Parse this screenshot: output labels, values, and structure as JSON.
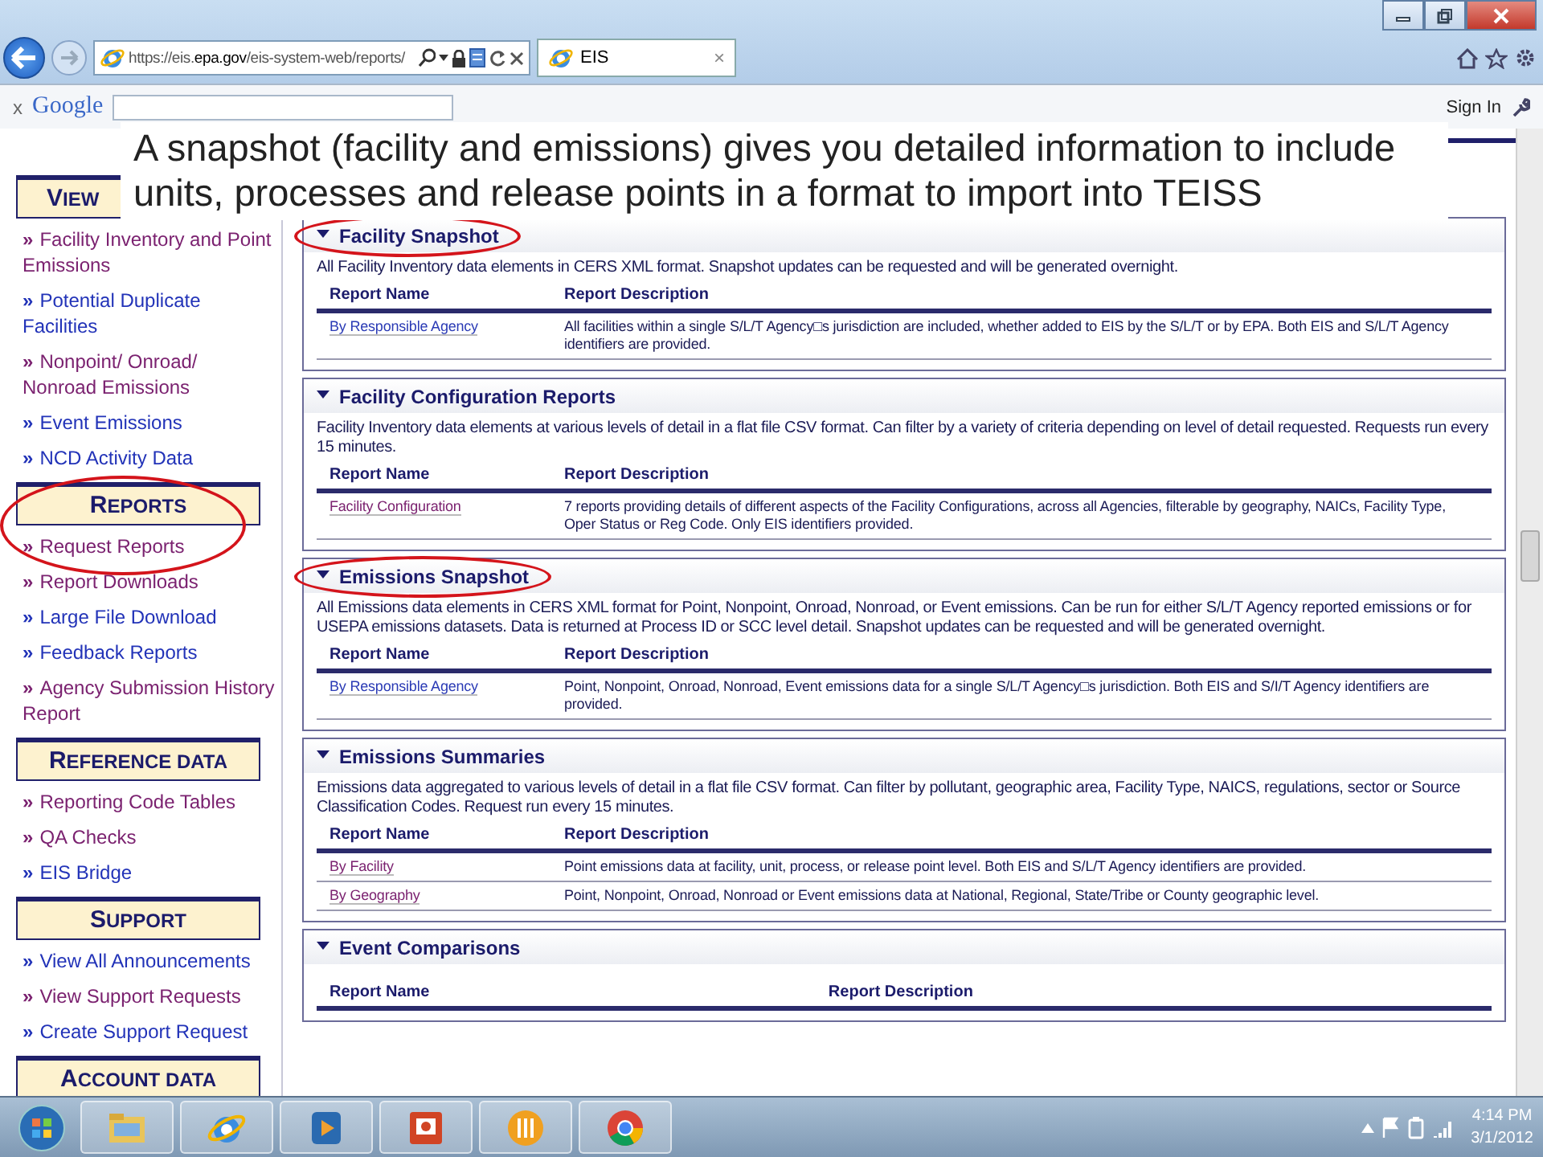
{
  "browser": {
    "address": "https://eis.**epa.gov**/eis-system-web/reports/",
    "tab": {
      "label": "EIS",
      "close": "×"
    }
  },
  "toolbar": {
    "close": "x",
    "brand": "Google",
    "sign_in": "Sign In"
  },
  "callout": {
    "text": "A snapshot (facility and emissions) gives you detailed information to include units, processes and release points in a format to import into TEISS"
  },
  "sidebar": {
    "sections": [
      {
        "heading": "VIEW",
        "circled": false,
        "items": [
          {
            "marker": "»",
            "label": "Facility Inventory and Point Emissions",
            "visited": true
          },
          {
            "marker": "»",
            "label": "Potential Duplicate Facilities",
            "visited": false
          },
          {
            "marker": "»",
            "label": "Nonpoint/ Onroad/ Nonroad Emissions",
            "visited": true
          },
          {
            "marker": "»",
            "label": "Event Emissions",
            "visited": false
          },
          {
            "marker": "»",
            "label": "NCD Activity Data",
            "visited": false
          }
        ]
      },
      {
        "heading": "REPORTS",
        "circled": true,
        "items": [
          {
            "marker": "»",
            "label": "Request Reports",
            "visited": true
          },
          {
            "marker": "»",
            "label": "Report Downloads",
            "visited": true
          },
          {
            "marker": "»",
            "label": "Large File Download",
            "visited": false
          },
          {
            "marker": "»",
            "label": "Feedback Reports",
            "visited": false
          },
          {
            "marker": "»",
            "label": "Agency Submission History Report",
            "visited": true
          }
        ]
      },
      {
        "heading": "REFERENCE DATA",
        "circled": false,
        "items": [
          {
            "marker": "»",
            "label": "Reporting Code Tables",
            "visited": true
          },
          {
            "marker": "»",
            "label": "QA Checks",
            "visited": true
          },
          {
            "marker": "»",
            "label": "EIS Bridge",
            "visited": false
          }
        ]
      },
      {
        "heading": "SUPPORT",
        "circled": false,
        "items": [
          {
            "marker": "»",
            "label": "View All Announcements",
            "visited": false
          },
          {
            "marker": "»",
            "label": "View Support Requests",
            "visited": true
          },
          {
            "marker": "»",
            "label": "Create Support Request",
            "visited": false
          }
        ]
      },
      {
        "heading": "ACCOUNT DATA",
        "circled": false
      }
    ]
  },
  "sections": [
    {
      "title": "Facility Snapshot",
      "expanded": true,
      "circled": true,
      "description": "All Facility Inventory data elements in CERS XML format. Snapshot updates can be requested and will be generated overnight.",
      "columns": [
        "Report Name",
        "Report Description"
      ],
      "rows": [
        {
          "name": "By Responsible Agency",
          "visited": false,
          "description": "All facilities within a single S/L/T Agency□s jurisdiction are included, whether added to EIS by the S/L/T or by EPA. Both EIS and S/L/T Agency identifiers are provided."
        }
      ]
    },
    {
      "title": "Facility Configuration Reports",
      "expanded": true,
      "circled": false,
      "description": "Facility Inventory data elements at various levels of detail in a flat file CSV format. Can filter by a variety of criteria depending on level of detail requested. Requests run every 15 minutes.",
      "columns": [
        "Report Name",
        "Report Description"
      ],
      "rows": [
        {
          "name": "Facility Configuration",
          "visited": true,
          "description": "7 reports providing details of different aspects of the Facility Configurations, across all Agencies, filterable by geography, NAICs, Facility Type, Oper Status or Reg Code. Only EIS identifiers provided."
        }
      ]
    },
    {
      "title": "Emissions Snapshot",
      "expanded": true,
      "circled": true,
      "description": "All Emissions data elements in CERS XML format for Point, Nonpoint, Onroad, Nonroad, or Event emissions. Can be run for either S/L/T Agency reported emissions or for USEPA emissions datasets. Data is returned at Process ID or SCC level detail. Snapshot updates can be requested and will be generated overnight.",
      "columns": [
        "Report Name",
        "Report Description"
      ],
      "rows": [
        {
          "name": "By Responsible Agency",
          "visited": false,
          "description": "Point, Nonpoint, Onroad, Nonroad, Event emissions data for a single S/L/T Agency□s jurisdiction. Both EIS and S/I/T Agency identifiers are provided."
        }
      ]
    },
    {
      "title": "Emissions Summaries",
      "expanded": true,
      "circled": false,
      "description": "Emissions data aggregated to various levels of detail in a flat file CSV format. Can filter by pollutant, geographic area, Facility Type, NAICS, regulations, sector or Source Classification Codes. Request run every 15 minutes.",
      "columns": [
        "Report Name",
        "Report Description"
      ],
      "rows": [
        {
          "name": "By Facility",
          "visited": true,
          "description": "Point emissions data at facility, unit, process, or release point level. Both EIS and S/L/T Agency identifiers are provided."
        },
        {
          "name": "By Geography",
          "visited": true,
          "description": "Point, Nonpoint, Onroad, Nonroad or Event emissions data at National, Regional, State/Tribe or County geographic level."
        }
      ]
    },
    {
      "title": "Event Comparisons",
      "expanded": true,
      "circled": false,
      "columns": [
        "Report Name",
        "Report Description"
      ]
    }
  ],
  "taskbar": {
    "time": "4:14 PM",
    "date": "3/1/2012"
  }
}
